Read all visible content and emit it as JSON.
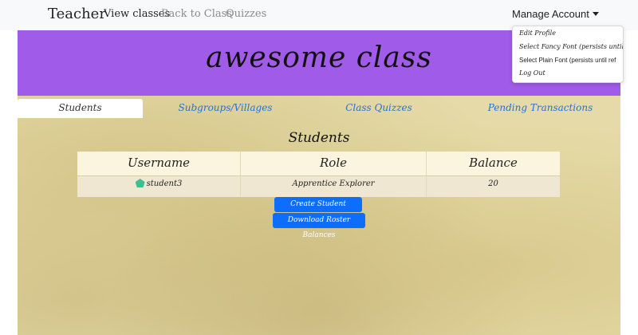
{
  "navbar": {
    "brand": "Teacher",
    "links": [
      "View classes",
      "Back to Class",
      "Quizzes"
    ],
    "account_label": "Manage Account"
  },
  "account_menu": {
    "items": [
      "Edit Profile",
      "Select Fancy Font (persists until re",
      "Select Plain Font (persists until ref",
      "Log Out"
    ]
  },
  "banner": {
    "title": "awesome class"
  },
  "tabs": [
    {
      "label": "Students",
      "active": true
    },
    {
      "label": "Subgroups/Villages",
      "active": false
    },
    {
      "label": "Class Quizzes",
      "active": false
    },
    {
      "label": "Pending Transactions",
      "active": false
    }
  ],
  "students": {
    "title": "Students",
    "columns": [
      "Username",
      "Role",
      "Balance"
    ],
    "rows": [
      {
        "username": "student3",
        "role": "Apprentice Explorer",
        "balance": "20"
      }
    ]
  },
  "buttons": {
    "create": "Create Student Accounts",
    "download": "Download Roster Balances"
  },
  "colors": {
    "banner": "#a15be9",
    "link": "#2a6fd6",
    "button": "#0d6efd",
    "parchment": "#e6dba8",
    "avatar": "#3fbf8f"
  }
}
